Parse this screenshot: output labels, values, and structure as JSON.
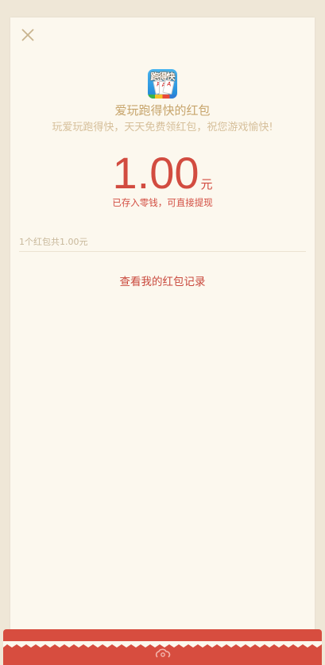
{
  "app": {
    "icon_name": "app-logo-icon",
    "logo_text": "跑得快"
  },
  "packet": {
    "title": "爱玩跑得快的红包",
    "subtitle": "玩爱玩跑得快，天天免费领红包，祝您游戏愉快!",
    "amount": "1.00",
    "unit": "元",
    "notice": "已存入零钱，可直接提现"
  },
  "summary": {
    "text": "1个红包共1.00元"
  },
  "records": {
    "link_label": "查看我的红包记录"
  },
  "colors": {
    "background": "#efe7d7",
    "card": "#fcf8ee",
    "gold": "#c7a56c",
    "red": "#d24c40"
  }
}
